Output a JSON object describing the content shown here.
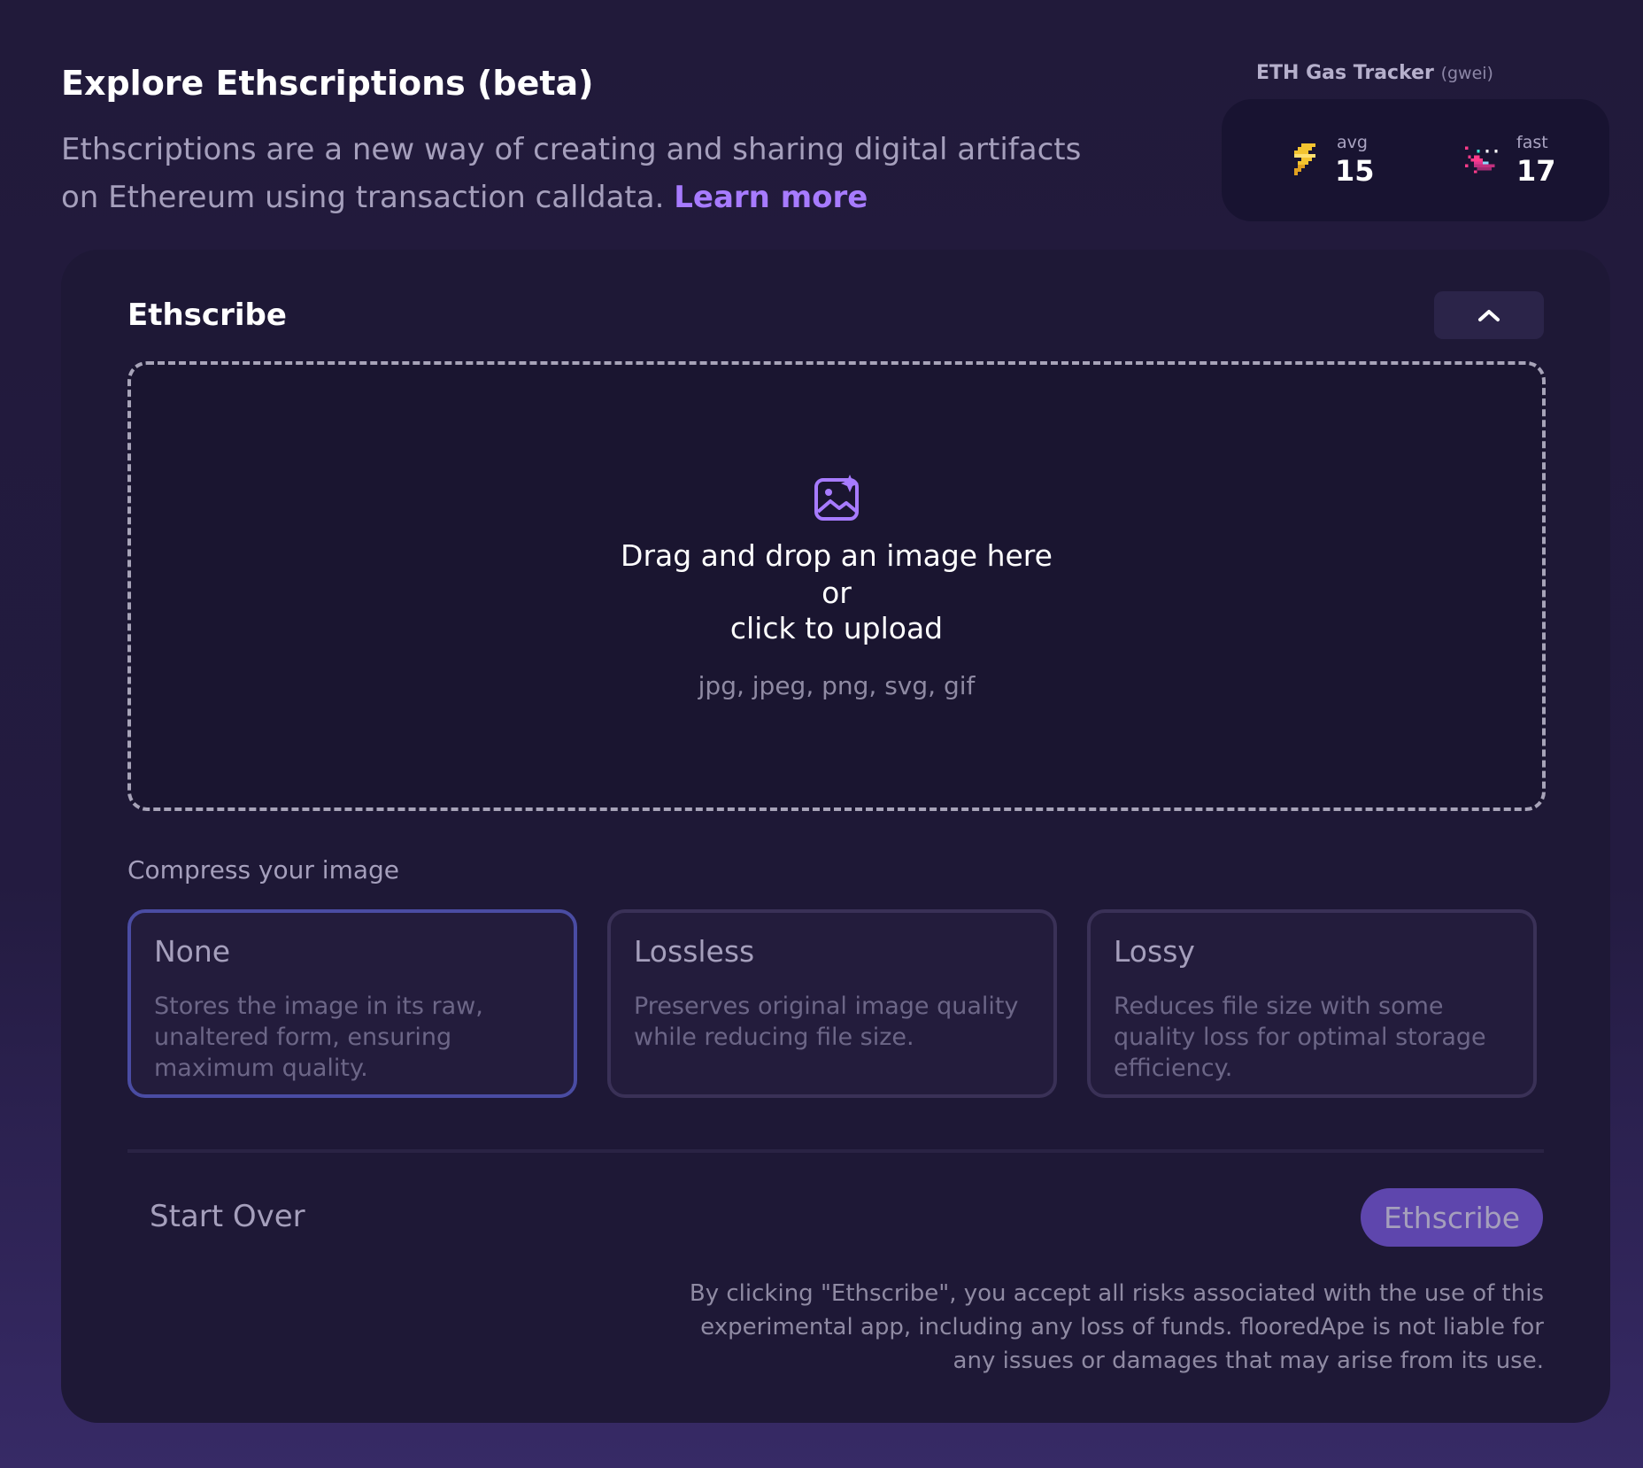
{
  "header": {
    "title": "Explore Ethscriptions (beta)",
    "intro_text": "Ethscriptions are a new way of creating and sharing digital artifacts on Ethereum using transaction calldata.",
    "learn_more": "Learn more"
  },
  "gas": {
    "title": "ETH Gas Tracker",
    "unit": "(gwei)",
    "avg_label": "avg",
    "avg_value": "15",
    "fast_label": "fast",
    "fast_value": "17",
    "avg_icon": "lightning-icon",
    "fast_icon": "pixel-rocket-icon"
  },
  "card": {
    "title": "Ethscribe",
    "collapse_icon": "chevron-up-icon",
    "dropzone": {
      "icon": "image-sparkle-icon",
      "line1": "Drag and drop an image here",
      "line2": "or",
      "line3": "click to upload",
      "formats": "jpg, jpeg, png, svg, gif"
    },
    "compress_label": "Compress your image",
    "options": [
      {
        "title": "None",
        "description": "Stores the image in its raw, unaltered form, ensuring maximum quality."
      },
      {
        "title": "Lossless",
        "description": "Preserves original image quality while reducing file size."
      },
      {
        "title": "Lossy",
        "description": "Reduces file size with some quality loss for optimal storage efficiency."
      }
    ],
    "selected_option": "None",
    "start_over": "Start Over",
    "submit": "Ethscribe",
    "disclaimer": "By clicking \"Ethscribe\", you accept all risks associated with the use of this experimental app, including any loss of funds. flooredApe is not liable for any issues or damages that may arise from its use."
  },
  "colors": {
    "accent": "#a77bff",
    "button": "#5e46ad",
    "selected_border": "#4a4ca3"
  }
}
